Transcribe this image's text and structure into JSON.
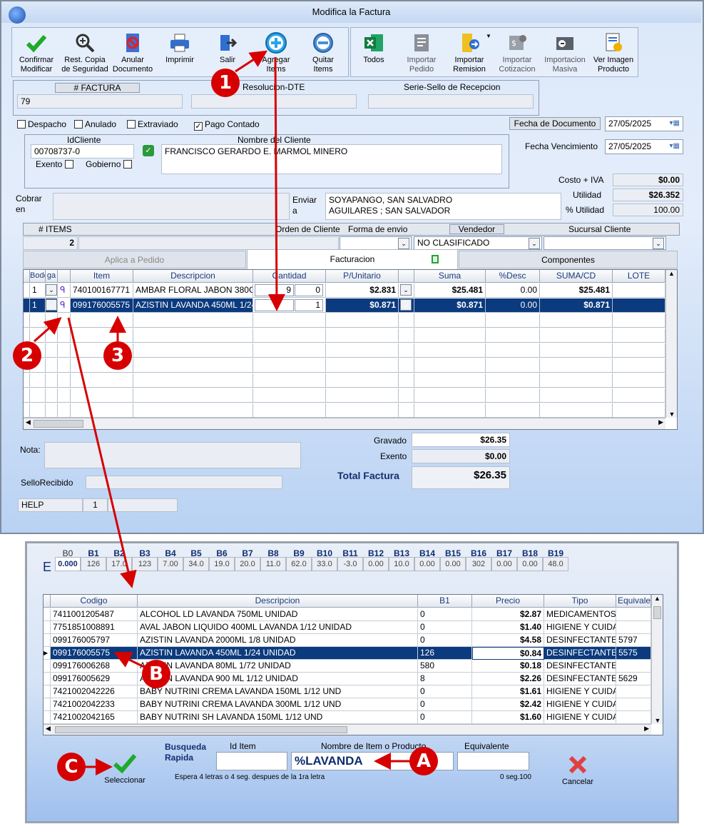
{
  "window": {
    "title": "Modifica la Factura"
  },
  "toolbar": {
    "confirmar": "Confirmar\nModificar",
    "rest_copia": "Rest. Copia\nde Seguridad",
    "anular": "Anular\nDocumento",
    "imprimir": "Imprimir",
    "salir": "Salir",
    "agregar": "Agregar\nItems",
    "quitar": "Quitar\nItems",
    "todos": "Todos",
    "importar_pedido": "Importar\nPedido",
    "importar_remision": "Importar\nRemision",
    "importar_cotizacion": "Importar\nCotizacion",
    "importacion_masiva": "Importacion\nMasiva",
    "ver_imagen": "Ver Imagen\nProducto"
  },
  "invoice": {
    "factura_label": "# FACTURA",
    "factura_value": "79",
    "resolucion_label": "Resolucion-DTE",
    "serie_label": "Serie-Sello de Recepcion",
    "despacho": "Despacho",
    "anulado": "Anulado",
    "extraviado": "Extraviado",
    "pago_contado": "Pago Contado",
    "pago_contado_check": "✓",
    "fecha_documento_label": "Fecha de  Documento",
    "fecha_documento": "27/05/2025",
    "fecha_vencimiento_label": "Fecha Vencimiento",
    "fecha_vencimiento": "27/05/2025"
  },
  "client": {
    "id_label": "IdCliente",
    "id_value": "00708737-0",
    "nombre_label": "Nombre del Cliente",
    "nombre_value": "FRANCISCO GERARDO E. MARMOL MINERO",
    "exento": "Exento",
    "gobierno": "Gobierno",
    "cobrar_label": "Cobrar\nen",
    "enviar_label": "Enviar\na",
    "enviar_line1": "SOYAPANGO, SAN SALVADRO",
    "enviar_line2": "AGUILARES ; SAN SALVADOR"
  },
  "costs": {
    "costo_iva_label": "Costo + IVA",
    "costo_iva": "$0.00",
    "utilidad_label": "Utilidad",
    "utilidad": "$26.352",
    "pct_utilidad_label": "% Utilidad",
    "pct_utilidad": "100.00"
  },
  "meta": {
    "items_label": "# ITEMS",
    "items_value": "2",
    "orden_label": "Orden de Cliente",
    "forma_label": "Forma de envio",
    "vendedor_label": "Vendedor",
    "vendedor_value": "NO CLASIFICADO",
    "sucursal_label": "Sucursal Cliente"
  },
  "tabs": {
    "aplica": "Aplica a Pedido",
    "facturacion": "Facturacion",
    "componentes": "Componentes"
  },
  "items_grid": {
    "headers": [
      "Bode",
      "ga",
      "Item",
      "Descripcion",
      "Cantidad",
      "P/Unitario",
      "Suma",
      "%Desc",
      "SUMA/CD",
      "LOTE"
    ],
    "rows": [
      {
        "bodega": "1",
        "item": "740100167771",
        "desc": "AMBAR FLORAL JABON 380G",
        "cant1": "9",
        "cant2": "0",
        "punit": "$2.831",
        "suma": "$25.481",
        "desc_pct": "0.00",
        "sumacd": "$25.481"
      },
      {
        "bodega": "1",
        "item": "099176005575",
        "desc": "AZISTIN LAVANDA 450ML 1/24",
        "cant1": "",
        "cant2": "1",
        "punit": "$0.871",
        "suma": "$0.871",
        "desc_pct": "0.00",
        "sumacd": "$0.871"
      }
    ]
  },
  "totals": {
    "nota_label": "Nota:",
    "sello_label": "SelloRecibido",
    "gravado_label": "Gravado",
    "gravado": "$26.35",
    "exento_label": "Exento",
    "exento": "$0.00",
    "total_label": "Total Factura",
    "total": "$26.35",
    "help": "HELP",
    "help_num": "1"
  },
  "search": {
    "e_label": "E",
    "bodegas": [
      "B0",
      "B1",
      "B2",
      "B3",
      "B4",
      "B5",
      "B6",
      "B7",
      "B8",
      "B9",
      "B10",
      "B11",
      "B12",
      "B13",
      "B14",
      "B15",
      "B16",
      "B17",
      "B18",
      "B19"
    ],
    "stock": [
      "0.000",
      "126",
      "17.0",
      "123",
      "7.00",
      "34.0",
      "19.0",
      "20.0",
      "11.0",
      "62.0",
      "33.0",
      "-3.0",
      "0.00",
      "10.0",
      "0.00",
      "0.00",
      "302",
      "0.00",
      "0.00",
      "48.0"
    ],
    "headers": [
      "Codigo",
      "Descripcion",
      "B1",
      "Precio",
      "Tipo",
      "Equivale"
    ],
    "rows": [
      {
        "codigo": "7411001205487",
        "desc": "ALCOHOL LD LAVANDA 750ML UNIDAD",
        "b1": "0",
        "precio": "$2.87",
        "tipo": "MEDICAMENTOS",
        "equiv": ""
      },
      {
        "codigo": "7751851008891",
        "desc": "AVAL JABON LIQUIDO 400ML LAVANDA  1/12 UNIDAD",
        "b1": "0",
        "precio": "$1.40",
        "tipo": "HIGIENE Y CUIDA",
        "equiv": ""
      },
      {
        "codigo": "099176005797",
        "desc": "AZISTIN LAVANDA 2000ML 1/8 UNIDAD",
        "b1": "0",
        "precio": "$4.58",
        "tipo": "DESINFECTANTE",
        "equiv": "5797"
      },
      {
        "codigo": "099176005575",
        "desc": "AZISTIN LAVANDA 450ML 1/24 UNIDAD",
        "b1": "126",
        "precio": "$0.84",
        "tipo": "DESINFECTANTE",
        "equiv": "5575"
      },
      {
        "codigo": "099176006268",
        "desc": "AZISTIN LAVANDA 80ML 1/72 UNIDAD",
        "b1": "580",
        "precio": "$0.18",
        "tipo": "DESINFECTANTE",
        "equiv": ""
      },
      {
        "codigo": "099176005629",
        "desc": "AZISTIN LAVANDA 900 ML 1/12 UNIDAD",
        "b1": "8",
        "precio": "$2.26",
        "tipo": "DESINFECTANTE",
        "equiv": "5629"
      },
      {
        "codigo": "7421002042226",
        "desc": "BABY NUTRINI CREMA LAVANDA 150ML 1/12 UND",
        "b1": "0",
        "precio": "$1.61",
        "tipo": "HIGIENE Y CUIDA",
        "equiv": ""
      },
      {
        "codigo": "7421002042233",
        "desc": "BABY NUTRINI CREMA LAVANDA 300ML 1/12 UND",
        "b1": "0",
        "precio": "$2.42",
        "tipo": "HIGIENE Y CUIDA",
        "equiv": ""
      },
      {
        "codigo": "7421002042165",
        "desc": "BABY NUTRINI SH LAVANDA 150ML 1/12 UND",
        "b1": "0",
        "precio": "$1.60",
        "tipo": "HIGIENE Y CUIDA",
        "equiv": ""
      }
    ],
    "busqueda_label": "Busqueda\nRapida",
    "id_item_label": "Id Item",
    "nombre_label": "Nombre de Item o Producto",
    "equiv_label": "Equivalente",
    "query": "%LAVANDA",
    "hint": "Espera 4 letras o 4 seg. despues de la 1ra letra",
    "timer": "0 seg.100",
    "seleccionar": "Seleccionar",
    "cancelar": "Cancelar"
  },
  "annotations": {
    "n1": "1",
    "n2": "2",
    "n3": "3",
    "a": "A",
    "b": "B",
    "c": "C"
  }
}
